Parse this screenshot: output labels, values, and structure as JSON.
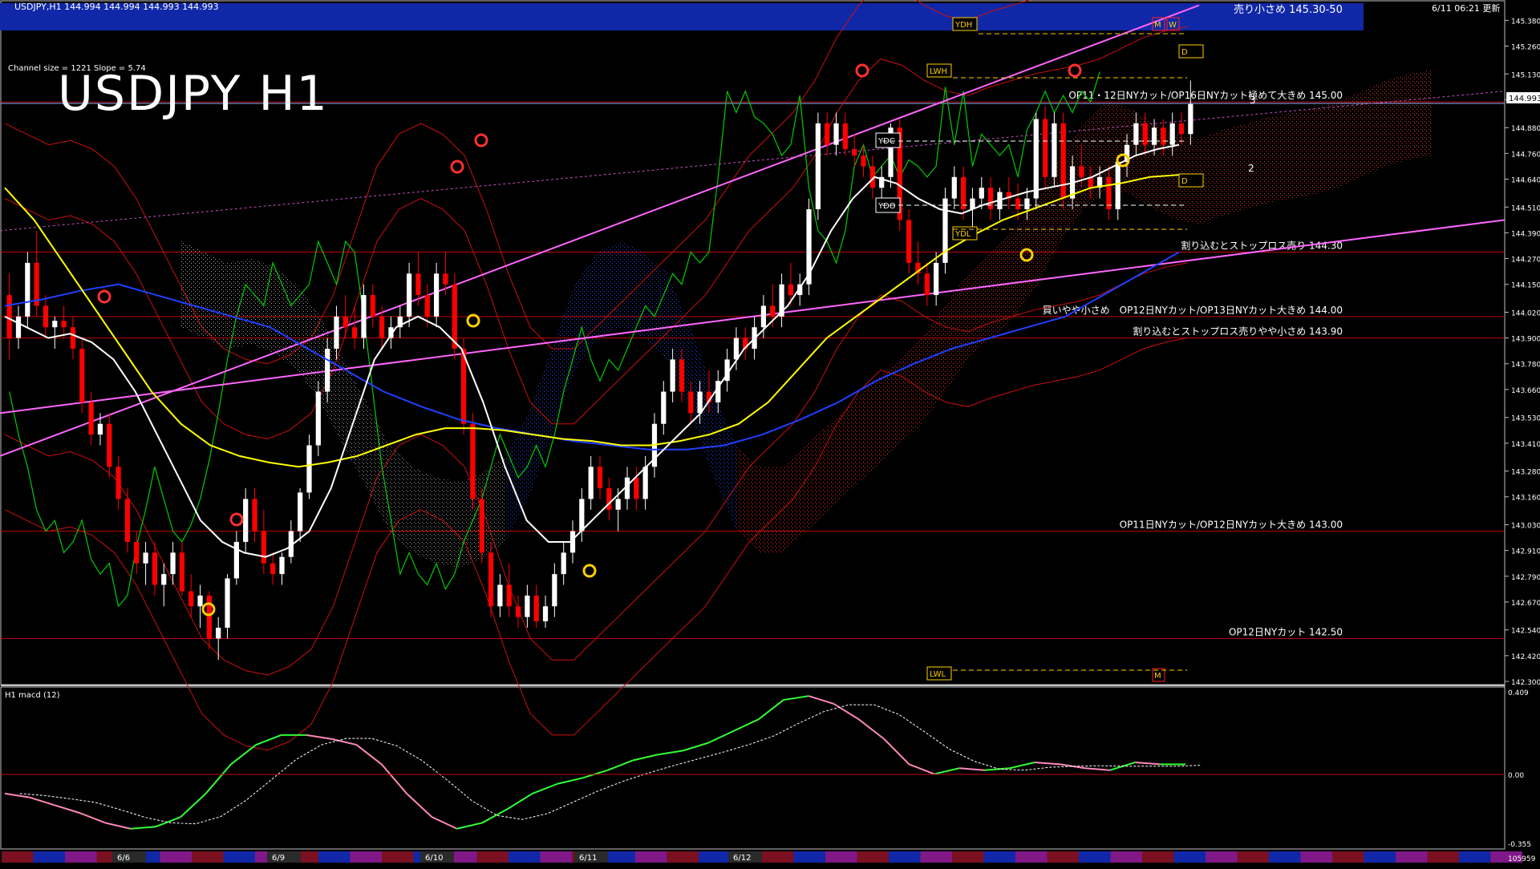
{
  "header": {
    "symbol_info": "USDJPY,H1  144.994 144.994 144.993 144.993",
    "datetime": "6/11 06:21 更新",
    "channel_info": "Channel size = 1221 Slope = 5.74",
    "big_title": "USDJPY H1"
  },
  "banner": {
    "text": "売り小さめ 145.30-50"
  },
  "markers": {
    "ydh": "YDH",
    "lwh": "LWH",
    "ydc": "YDC",
    "ydo": "YDO",
    "ydl": "YDL",
    "lwl": "LWL",
    "m": "M",
    "w": "W",
    "d": "D"
  },
  "levels": [
    {
      "price": 145.0,
      "label": "OP11・12日NYカット/OP16日NYカット極めて大きめ 145.00"
    },
    {
      "price": 144.3,
      "label": "割り込むとストップロス売り 144.30"
    },
    {
      "price": 144.0,
      "label": "買いやや小さめ　OP12日NYカット/OP13日NYカット大きめ 144.00"
    },
    {
      "price": 143.9,
      "label": "割り込むとストップロス売りやや小さめ 143.90"
    },
    {
      "price": 143.0,
      "label": "OP11日NYカット/OP12日NYカット大きめ 143.00"
    },
    {
      "price": 142.5,
      "label": "OP12日NYカット 142.50"
    }
  ],
  "current_price": "144.993",
  "projection_labels": [
    "3",
    "2"
  ],
  "macd": {
    "label": "H1  macd (12)",
    "axis": [
      "0.409",
      "0.00",
      "-0.355"
    ]
  },
  "footer": {
    "dates": [
      "6/6",
      "6/9",
      "6/10",
      "6/11",
      "6/12"
    ],
    "right_value": "105959"
  },
  "colors": {
    "background": "#000000",
    "banner": "#1028a8",
    "bull": "#ffffff",
    "bear": "#ff0000",
    "sma_white": "#ffffff",
    "sma_yellow": "#ffff00",
    "sma_blue": "#2040ff",
    "channel": "#ff66ff",
    "level": "#c00000",
    "macd_up": "#33ff33",
    "macd_down": "#ff88bb",
    "chikou": "#00cc00"
  },
  "chart_data": {
    "type": "candlestick",
    "instrument": "USDJPY",
    "timeframe": "H1",
    "y_axis_ticks": [
      145.38,
      145.26,
      145.13,
      145.01,
      144.88,
      144.76,
      144.64,
      144.51,
      144.39,
      144.27,
      144.15,
      144.02,
      143.9,
      143.78,
      143.66,
      143.53,
      143.41,
      143.28,
      143.16,
      143.03,
      142.91,
      142.79,
      142.67,
      142.54,
      142.42,
      142.3
    ],
    "ylim": [
      142.3,
      145.4
    ],
    "candles": [
      [
        144.1,
        144.2,
        143.8,
        143.9
      ],
      [
        143.9,
        144.05,
        143.85,
        144.0
      ],
      [
        144.0,
        144.3,
        143.95,
        144.25
      ],
      [
        144.25,
        144.4,
        144.0,
        144.05
      ],
      [
        144.05,
        144.1,
        143.9,
        143.95
      ],
      [
        143.95,
        144.0,
        143.85,
        143.98
      ],
      [
        143.98,
        144.05,
        143.9,
        143.95
      ],
      [
        143.95,
        144.0,
        143.8,
        143.85
      ],
      [
        143.85,
        143.9,
        143.55,
        143.6
      ],
      [
        143.6,
        143.65,
        143.4,
        143.45
      ],
      [
        143.45,
        143.55,
        143.4,
        143.5
      ],
      [
        143.5,
        143.55,
        143.25,
        143.3
      ],
      [
        143.3,
        143.35,
        143.1,
        143.15
      ],
      [
        143.15,
        143.2,
        142.9,
        142.95
      ],
      [
        142.95,
        143.0,
        142.8,
        142.85
      ],
      [
        142.85,
        142.95,
        142.75,
        142.9
      ],
      [
        142.9,
        142.95,
        142.7,
        142.75
      ],
      [
        142.75,
        142.85,
        142.65,
        142.8
      ],
      [
        142.8,
        142.95,
        142.75,
        142.9
      ],
      [
        142.9,
        142.95,
        142.7,
        142.72
      ],
      [
        142.72,
        142.8,
        142.6,
        142.65
      ],
      [
        142.65,
        142.75,
        142.55,
        142.7
      ],
      [
        142.7,
        142.72,
        142.45,
        142.5
      ],
      [
        142.5,
        142.6,
        142.4,
        142.55
      ],
      [
        142.55,
        142.8,
        142.5,
        142.78
      ],
      [
        142.78,
        143.0,
        142.75,
        142.95
      ],
      [
        142.95,
        143.2,
        142.9,
        143.15
      ],
      [
        143.15,
        143.2,
        142.95,
        143.0
      ],
      [
        143.0,
        143.1,
        142.8,
        142.85
      ],
      [
        142.85,
        142.9,
        142.75,
        142.8
      ],
      [
        142.8,
        142.9,
        142.75,
        142.88
      ],
      [
        142.88,
        143.05,
        142.85,
        143.0
      ],
      [
        143.0,
        143.2,
        142.95,
        143.18
      ],
      [
        143.18,
        143.45,
        143.15,
        143.4
      ],
      [
        143.4,
        143.7,
        143.35,
        143.65
      ],
      [
        143.65,
        143.9,
        143.6,
        143.85
      ],
      [
        143.85,
        144.05,
        143.8,
        144.0
      ],
      [
        144.0,
        144.1,
        143.9,
        143.95
      ],
      [
        143.95,
        144.05,
        143.85,
        143.9
      ],
      [
        143.9,
        144.15,
        143.85,
        144.1
      ],
      [
        144.1,
        144.15,
        143.95,
        144.0
      ],
      [
        144.0,
        144.05,
        143.85,
        143.9
      ],
      [
        143.9,
        144.0,
        143.85,
        143.95
      ],
      [
        143.95,
        144.05,
        143.9,
        144.0
      ],
      [
        144.0,
        144.25,
        143.95,
        144.2
      ],
      [
        144.2,
        144.3,
        144.05,
        144.1
      ],
      [
        144.1,
        144.15,
        143.95,
        144.0
      ],
      [
        144.0,
        144.25,
        143.95,
        144.2
      ],
      [
        144.2,
        144.3,
        144.1,
        144.15
      ],
      [
        144.15,
        144.2,
        143.8,
        143.85
      ],
      [
        143.85,
        143.9,
        143.45,
        143.5
      ],
      [
        143.5,
        143.55,
        143.1,
        143.15
      ],
      [
        143.15,
        143.2,
        142.85,
        142.9
      ],
      [
        142.9,
        142.95,
        142.6,
        142.65
      ],
      [
        142.65,
        142.8,
        142.6,
        142.75
      ],
      [
        142.75,
        142.85,
        142.6,
        142.65
      ],
      [
        142.65,
        142.7,
        142.55,
        142.6
      ],
      [
        142.6,
        142.75,
        142.55,
        142.7
      ],
      [
        142.7,
        142.75,
        142.55,
        142.58
      ],
      [
        142.58,
        142.7,
        142.55,
        142.65
      ],
      [
        142.65,
        142.85,
        142.6,
        142.8
      ],
      [
        142.8,
        142.95,
        142.75,
        142.9
      ],
      [
        142.9,
        143.05,
        142.85,
        143.0
      ],
      [
        143.0,
        143.2,
        142.95,
        143.15
      ],
      [
        143.15,
        143.35,
        143.1,
        143.3
      ],
      [
        143.3,
        143.35,
        143.15,
        143.2
      ],
      [
        143.2,
        143.25,
        143.05,
        143.1
      ],
      [
        143.1,
        143.2,
        143.0,
        143.15
      ],
      [
        143.15,
        143.3,
        143.1,
        143.25
      ],
      [
        143.25,
        143.3,
        143.1,
        143.15
      ],
      [
        143.15,
        143.35,
        143.1,
        143.3
      ],
      [
        143.3,
        143.55,
        143.25,
        143.5
      ],
      [
        143.5,
        143.7,
        143.45,
        143.65
      ],
      [
        143.65,
        143.85,
        143.6,
        143.8
      ],
      [
        143.8,
        143.85,
        143.6,
        143.65
      ],
      [
        143.65,
        143.7,
        143.5,
        143.55
      ],
      [
        143.55,
        143.7,
        143.5,
        143.65
      ],
      [
        143.65,
        143.75,
        143.55,
        143.6
      ],
      [
        143.6,
        143.75,
        143.55,
        143.7
      ],
      [
        143.7,
        143.85,
        143.65,
        143.8
      ],
      [
        143.8,
        143.95,
        143.75,
        143.9
      ],
      [
        143.9,
        143.95,
        143.8,
        143.85
      ],
      [
        143.85,
        144.0,
        143.8,
        143.95
      ],
      [
        143.95,
        144.1,
        143.9,
        144.05
      ],
      [
        144.05,
        144.15,
        143.95,
        144.0
      ],
      [
        144.0,
        144.2,
        143.95,
        144.15
      ],
      [
        144.15,
        144.25,
        144.05,
        144.1
      ],
      [
        144.1,
        144.2,
        144.05,
        144.15
      ],
      [
        144.15,
        144.55,
        144.1,
        144.5
      ],
      [
        144.5,
        144.95,
        144.45,
        144.9
      ],
      [
        144.9,
        144.95,
        144.75,
        144.8
      ],
      [
        144.8,
        144.95,
        144.75,
        144.9
      ],
      [
        144.9,
        144.95,
        144.75,
        144.78
      ],
      [
        144.78,
        144.85,
        144.7,
        144.75
      ],
      [
        144.75,
        144.8,
        144.65,
        144.7
      ],
      [
        144.7,
        144.75,
        144.55,
        144.6
      ],
      [
        144.6,
        144.7,
        144.55,
        144.65
      ],
      [
        144.65,
        144.9,
        144.6,
        144.88
      ],
      [
        144.88,
        144.92,
        144.4,
        144.45
      ],
      [
        144.45,
        144.5,
        144.2,
        144.25
      ],
      [
        144.25,
        144.35,
        144.15,
        144.2
      ],
      [
        144.2,
        144.25,
        144.05,
        144.1
      ],
      [
        144.1,
        144.3,
        144.05,
        144.25
      ],
      [
        144.25,
        144.6,
        144.2,
        144.55
      ],
      [
        144.55,
        144.7,
        144.5,
        144.65
      ],
      [
        144.65,
        144.7,
        144.45,
        144.5
      ],
      [
        144.5,
        144.6,
        144.4,
        144.55
      ],
      [
        144.55,
        144.65,
        144.5,
        144.6
      ],
      [
        144.6,
        144.65,
        144.45,
        144.5
      ],
      [
        144.5,
        144.6,
        144.45,
        144.58
      ],
      [
        144.58,
        144.65,
        144.5,
        144.55
      ],
      [
        144.55,
        144.62,
        144.45,
        144.5
      ],
      [
        144.5,
        144.6,
        144.45,
        144.55
      ],
      [
        144.55,
        144.95,
        144.5,
        144.92
      ],
      [
        144.92,
        144.98,
        144.6,
        144.65
      ],
      [
        144.65,
        144.95,
        144.6,
        144.9
      ],
      [
        144.9,
        144.95,
        144.5,
        144.55
      ],
      [
        144.55,
        144.75,
        144.5,
        144.7
      ],
      [
        144.7,
        144.8,
        144.6,
        144.65
      ],
      [
        144.65,
        144.7,
        144.55,
        144.6
      ],
      [
        144.6,
        144.7,
        144.55,
        144.65
      ],
      [
        144.65,
        144.7,
        144.45,
        144.5
      ],
      [
        144.5,
        144.75,
        144.45,
        144.72
      ],
      [
        144.72,
        144.85,
        144.65,
        144.8
      ],
      [
        144.8,
        144.95,
        144.75,
        144.9
      ],
      [
        144.9,
        144.95,
        144.75,
        144.8
      ],
      [
        144.8,
        144.92,
        144.75,
        144.88
      ],
      [
        144.88,
        144.92,
        144.75,
        144.8
      ],
      [
        144.8,
        144.95,
        144.75,
        144.9
      ],
      [
        144.9,
        144.95,
        144.8,
        144.85
      ],
      [
        144.85,
        145.1,
        144.8,
        144.99
      ]
    ],
    "sma_white": [
      144.0,
      143.95,
      143.9,
      143.92,
      143.88,
      143.8,
      143.65,
      143.45,
      143.25,
      143.05,
      142.95,
      142.9,
      142.88,
      142.92,
      143.0,
      143.2,
      143.5,
      143.8,
      143.95,
      144.0,
      143.95,
      143.85,
      143.6,
      143.3,
      143.05,
      142.95,
      142.95,
      143.05,
      143.15,
      143.25,
      143.35,
      143.45,
      143.55,
      143.7,
      143.85,
      143.95,
      144.05,
      144.2,
      144.4,
      144.55,
      144.65,
      144.62,
      144.55,
      144.5,
      144.48,
      144.52,
      144.55,
      144.58,
      144.6,
      144.62,
      144.65,
      144.7,
      144.75,
      144.78,
      144.8
    ],
    "sma_yellow": [
      144.6,
      144.45,
      144.25,
      144.05,
      143.85,
      143.65,
      143.5,
      143.4,
      143.35,
      143.32,
      143.3,
      143.32,
      143.35,
      143.4,
      143.45,
      143.48,
      143.48,
      143.47,
      143.45,
      143.43,
      143.42,
      143.4,
      143.4,
      143.42,
      143.45,
      143.5,
      143.6,
      143.75,
      143.9,
      144.0,
      144.1,
      144.2,
      144.3,
      144.38,
      144.45,
      144.5,
      144.55,
      144.6,
      144.62,
      144.65,
      144.66
    ],
    "sma_blue": [
      144.05,
      144.08,
      144.12,
      144.15,
      144.1,
      144.05,
      144.0,
      143.95,
      143.85,
      143.75,
      143.65,
      143.58,
      143.52,
      143.48,
      143.45,
      143.42,
      143.4,
      143.38,
      143.38,
      143.4,
      143.45,
      143.52,
      143.6,
      143.7,
      143.78,
      143.85,
      143.9,
      143.95,
      144.0,
      144.1,
      144.2,
      144.3
    ],
    "macd_main": [
      -0.1,
      -0.12,
      -0.16,
      -0.2,
      -0.25,
      -0.28,
      -0.27,
      -0.22,
      -0.1,
      0.05,
      0.15,
      0.2,
      0.2,
      0.18,
      0.15,
      0.05,
      -0.1,
      -0.22,
      -0.28,
      -0.25,
      -0.18,
      -0.1,
      -0.05,
      -0.02,
      0.02,
      0.07,
      0.1,
      0.12,
      0.16,
      0.22,
      0.28,
      0.38,
      0.4,
      0.36,
      0.28,
      0.18,
      0.05,
      0.0,
      0.03,
      0.02,
      0.03,
      0.06,
      0.05,
      0.03,
      0.02,
      0.06,
      0.05,
      0.05
    ]
  }
}
